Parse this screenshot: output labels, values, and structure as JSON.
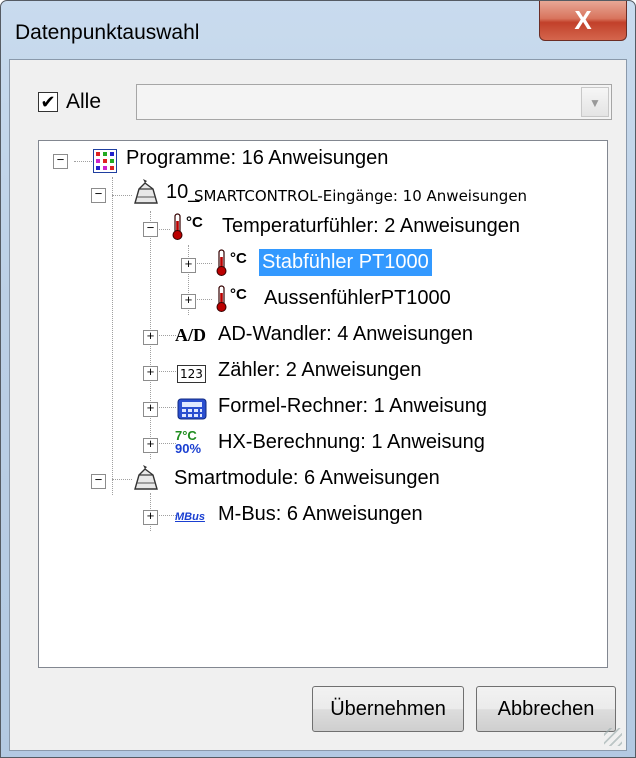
{
  "window": {
    "title": "Datenpunktauswahl",
    "close_glyph": "X"
  },
  "filter": {
    "all_checked": true,
    "all_label": "Alle",
    "combo_value": ""
  },
  "tree": {
    "root": {
      "label": "Programme: 16 Anweisungen",
      "icon": "grid-program-icon"
    },
    "n1": {
      "label_prefix": "10_",
      "label": "SMARTCONTROL-Eingänge: 10 Anweisungen",
      "icon": "module-icon"
    },
    "n1a": {
      "label": "Temperaturfühler: 2 Anweisungen",
      "icon": "thermometer-icon",
      "icon_text": "°C"
    },
    "n1a1": {
      "label": "Stabfühler PT1000",
      "icon": "thermometer-icon",
      "icon_text": "°C",
      "selected": true
    },
    "n1a2": {
      "label": "AussenfühlerPT1000",
      "icon": "thermometer-icon",
      "icon_text": "°C"
    },
    "n1b": {
      "label": "AD-Wandler: 4 Anweisungen",
      "icon": "ad-converter-icon",
      "icon_text": "A/D"
    },
    "n1c": {
      "label": "Zähler: 2 Anweisungen",
      "icon": "counter-icon",
      "icon_text": "123"
    },
    "n1d": {
      "label": "Formel-Rechner: 1 Anweisung",
      "icon": "calculator-icon"
    },
    "n1e": {
      "label": "HX-Berechnung: 1 Anweisung",
      "icon": "hx-icon",
      "icon_text_top": "7°C",
      "icon_text_bottom": "90%"
    },
    "n2": {
      "label": "Smartmodule: 6 Anweisungen",
      "icon": "module-icon"
    },
    "n2a": {
      "label": "M-Bus: 6 Anweisungen",
      "icon": "mbus-icon",
      "icon_text": "MBus"
    }
  },
  "buttons": {
    "apply": "Übernehmen",
    "cancel": "Abbrechen"
  },
  "colors": {
    "selection": "#3399ff",
    "close": "#c2402a",
    "mbus": "#1a3fd1",
    "hx_green": "#1e8c1e",
    "hx_blue": "#1a3fd1"
  }
}
